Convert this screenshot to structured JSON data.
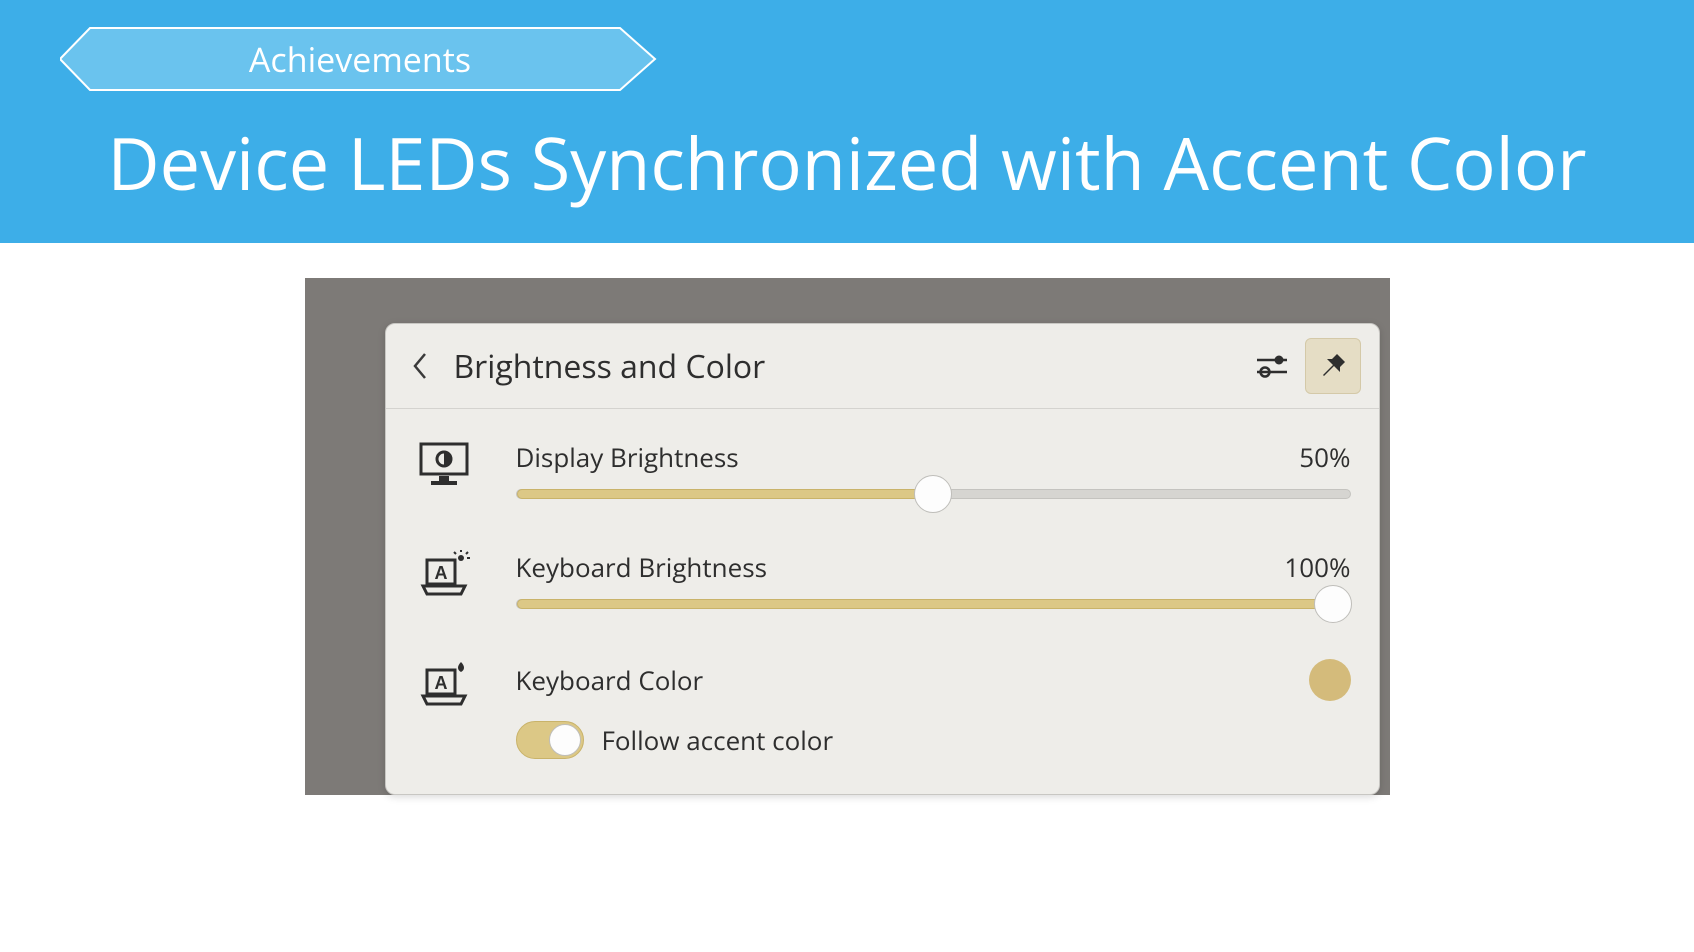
{
  "header": {
    "ribbon_label": "Achievements",
    "title": "Device LEDs Synchronized with Accent Color"
  },
  "popup": {
    "title": "Brightness and Color",
    "display": {
      "label": "Display Brightness",
      "value": "50%",
      "percent": 50
    },
    "keyboard": {
      "label": "Keyboard Brightness",
      "value": "100%",
      "percent": 100
    },
    "keyboard_color": {
      "label": "Keyboard Color",
      "swatch": "#d4bb7b",
      "toggle_label": "Follow accent color",
      "toggle_on": true
    }
  },
  "colors": {
    "banner": "#3daee8",
    "accent": "#dcc886",
    "panel_bg": "#eeede9"
  }
}
